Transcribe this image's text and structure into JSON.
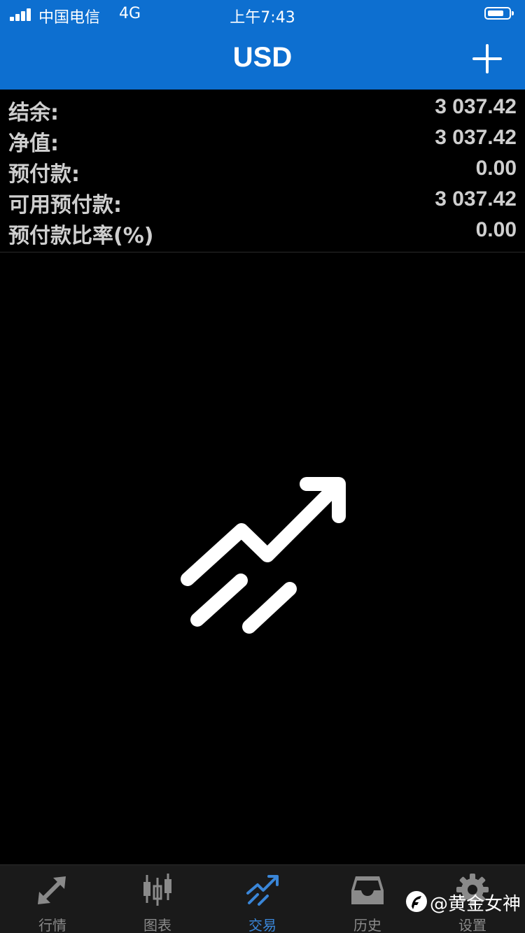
{
  "status_bar": {
    "carrier": "中国电信",
    "network": "4G",
    "time": "上午7:43"
  },
  "nav": {
    "title": "USD",
    "add_icon": "plus-icon"
  },
  "summary": [
    {
      "label": "结余:",
      "value": "3 037.42"
    },
    {
      "label": "净值:",
      "value": "3 037.42"
    },
    {
      "label": "预付款:",
      "value": "0.00"
    },
    {
      "label": "可用预付款:",
      "value": "3 037.42"
    },
    {
      "label": "预付款比率(%)",
      "value": "0.00"
    }
  ],
  "empty_state": {
    "icon": "trade-trend-arrow-icon"
  },
  "tabs": [
    {
      "label": "行情",
      "icon": "quotes-arrows-icon",
      "active": false
    },
    {
      "label": "图表",
      "icon": "candlestick-chart-icon",
      "active": false
    },
    {
      "label": "交易",
      "icon": "trade-trend-icon",
      "active": true
    },
    {
      "label": "历史",
      "icon": "history-inbox-icon",
      "active": false
    },
    {
      "label": "设置",
      "icon": "gear-icon",
      "active": false
    }
  ],
  "watermark": {
    "text": "@黄金女神",
    "icon": "watermark-logo-icon"
  },
  "colors": {
    "header_blue": "#0d6fd0",
    "background": "#000000",
    "tabbar_bg": "#1a1a1a",
    "active_tab": "#3a86d8",
    "inactive_tab": "#8a8a8a",
    "summary_text": "#cfcfcf"
  }
}
